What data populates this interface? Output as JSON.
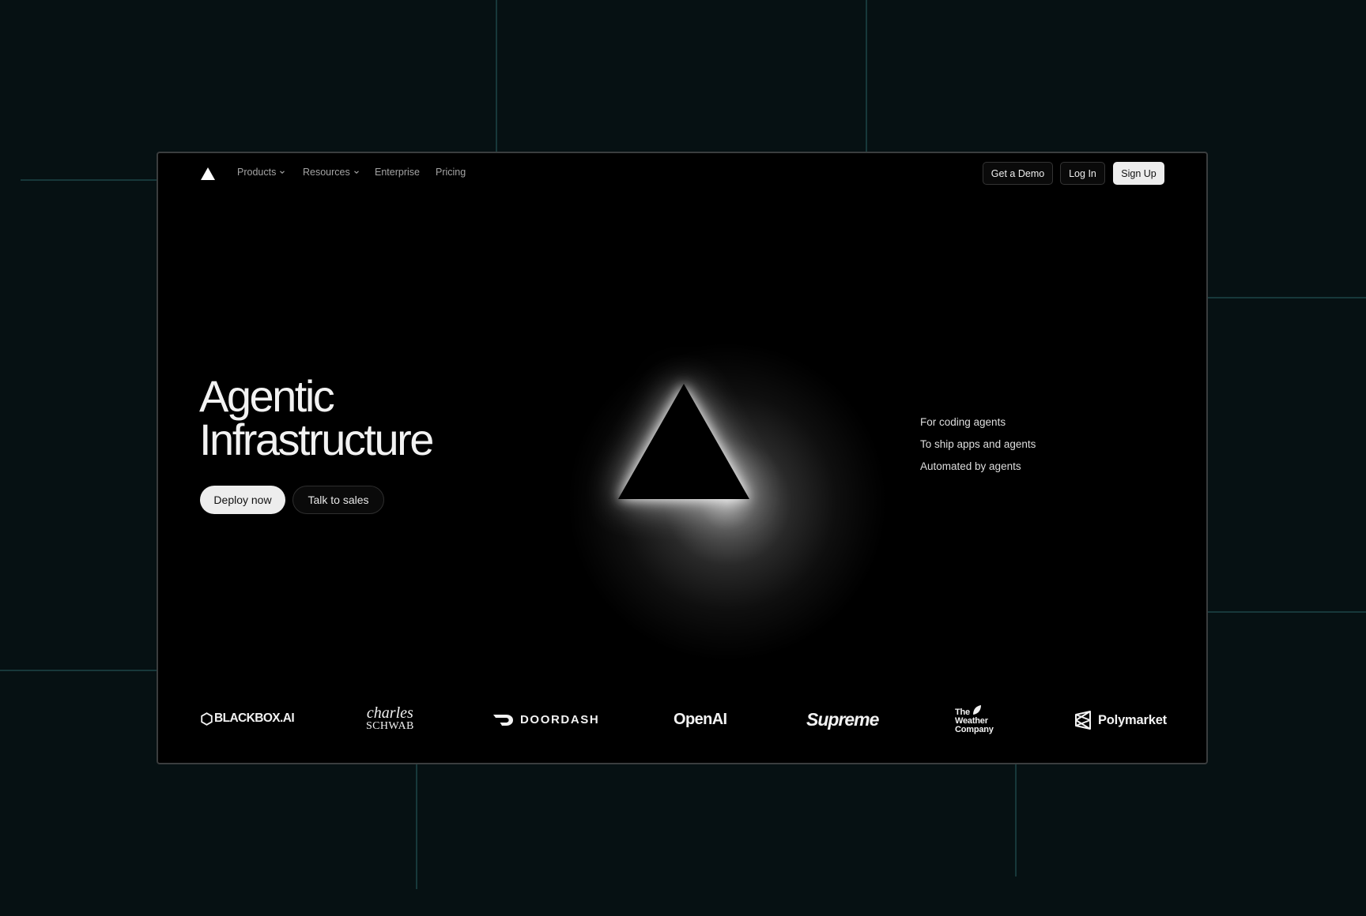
{
  "nav": {
    "logo_icon": "triangle-logo-icon",
    "items": [
      {
        "label": "Products",
        "has_dropdown": true
      },
      {
        "label": "Resources",
        "has_dropdown": true
      },
      {
        "label": "Enterprise",
        "has_dropdown": false
      },
      {
        "label": "Pricing",
        "has_dropdown": false
      }
    ],
    "actions": {
      "demo": "Get a Demo",
      "login": "Log In",
      "signup": "Sign Up"
    }
  },
  "hero": {
    "title_line1": "Agentic",
    "title_line2": "Infrastructure",
    "primary_cta": "Deploy now",
    "secondary_cta": "Talk to sales",
    "taglines": [
      "For coding agents",
      "To ship apps and agents",
      "Automated by agents"
    ]
  },
  "customers": {
    "blackbox": "BLACKBOX.AI",
    "schwab_top": "charles",
    "schwab_bottom": "SCHWAB",
    "doordash": "DOORDASH",
    "openai": "OpenAI",
    "supreme": "Supreme",
    "weather": [
      "The",
      "Weather",
      "Company"
    ],
    "polymarket": "Polymarket"
  },
  "colors": {
    "page_background": "#061113",
    "grid_lines": "#17383a",
    "frame_background": "#000000",
    "primary_button": "#ededed"
  }
}
